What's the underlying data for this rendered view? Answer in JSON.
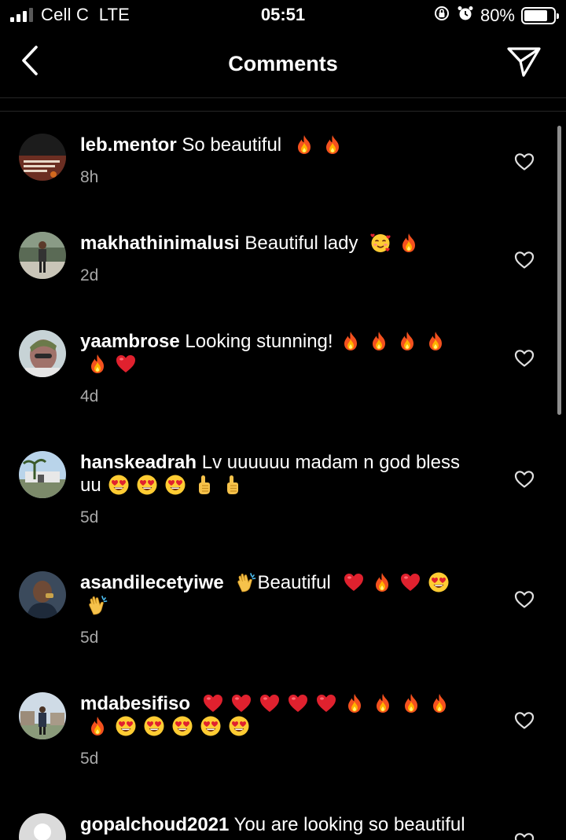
{
  "status_bar": {
    "carrier": "Cell C",
    "network": "LTE",
    "time": "05:51",
    "battery_percent": "80%",
    "battery_level": 0.8,
    "icons": [
      "signal-icon",
      "orientation-lock-icon",
      "alarm-icon",
      "battery-icon"
    ]
  },
  "nav": {
    "title": "Comments",
    "back_icon": "chevron-left-icon",
    "send_icon": "paper-plane-icon"
  },
  "comments": [
    {
      "username": "leb.mentor",
      "segments": [
        {
          "t": "text",
          "v": " So beautiful "
        },
        {
          "t": "emoji",
          "v": "fire"
        },
        {
          "t": "emoji",
          "v": "fire"
        }
      ],
      "time": "8h"
    },
    {
      "username": "makhathinimalusi",
      "segments": [
        {
          "t": "text",
          "v": " Beautiful lady "
        },
        {
          "t": "emoji",
          "v": "smiling-hearts"
        },
        {
          "t": "emoji",
          "v": "fire"
        }
      ],
      "time": "2d"
    },
    {
      "username": "yaambrose",
      "segments": [
        {
          "t": "text",
          "v": " Looking stunning!"
        },
        {
          "t": "emoji",
          "v": "fire"
        },
        {
          "t": "emoji",
          "v": "fire"
        },
        {
          "t": "emoji",
          "v": "fire"
        },
        {
          "t": "emoji",
          "v": "fire"
        },
        {
          "t": "emoji",
          "v": "fire"
        },
        {
          "t": "emoji",
          "v": "red-heart"
        }
      ],
      "time": "4d"
    },
    {
      "username": "hanskeadrah",
      "segments": [
        {
          "t": "text",
          "v": " Lv uuuuuu madam n god bless uu"
        },
        {
          "t": "emoji",
          "v": "heart-eyes"
        },
        {
          "t": "emoji",
          "v": "heart-eyes"
        },
        {
          "t": "emoji",
          "v": "heart-eyes"
        },
        {
          "t": "emoji",
          "v": "point-up"
        },
        {
          "t": "emoji",
          "v": "point-up"
        }
      ],
      "time": "5d"
    },
    {
      "username": "asandilecetyiwe",
      "segments": [
        {
          "t": "text",
          "v": " "
        },
        {
          "t": "emoji",
          "v": "clap"
        },
        {
          "t": "text",
          "v": "Beautiful "
        },
        {
          "t": "emoji",
          "v": "red-heart"
        },
        {
          "t": "emoji",
          "v": "fire"
        },
        {
          "t": "emoji",
          "v": "red-heart"
        },
        {
          "t": "emoji",
          "v": "heart-eyes"
        },
        {
          "t": "emoji",
          "v": "clap"
        }
      ],
      "time": "5d"
    },
    {
      "username": "mdabesifiso",
      "segments": [
        {
          "t": "text",
          "v": " "
        },
        {
          "t": "emoji",
          "v": "red-heart"
        },
        {
          "t": "emoji",
          "v": "red-heart"
        },
        {
          "t": "emoji",
          "v": "red-heart"
        },
        {
          "t": "emoji",
          "v": "red-heart"
        },
        {
          "t": "emoji",
          "v": "red-heart"
        },
        {
          "t": "emoji",
          "v": "fire"
        },
        {
          "t": "emoji",
          "v": "fire"
        },
        {
          "t": "emoji",
          "v": "fire"
        },
        {
          "t": "emoji",
          "v": "fire"
        },
        {
          "t": "emoji",
          "v": "fire"
        },
        {
          "t": "emoji",
          "v": "heart-eyes"
        },
        {
          "t": "emoji",
          "v": "heart-eyes"
        },
        {
          "t": "emoji",
          "v": "heart-eyes"
        },
        {
          "t": "emoji",
          "v": "heart-eyes"
        },
        {
          "t": "emoji",
          "v": "heart-eyes"
        }
      ],
      "time": "5d"
    },
    {
      "username": "gopalchoud2021",
      "segments": [
        {
          "t": "text",
          "v": " You are looking so beautiful"
        }
      ],
      "time": ""
    }
  ]
}
